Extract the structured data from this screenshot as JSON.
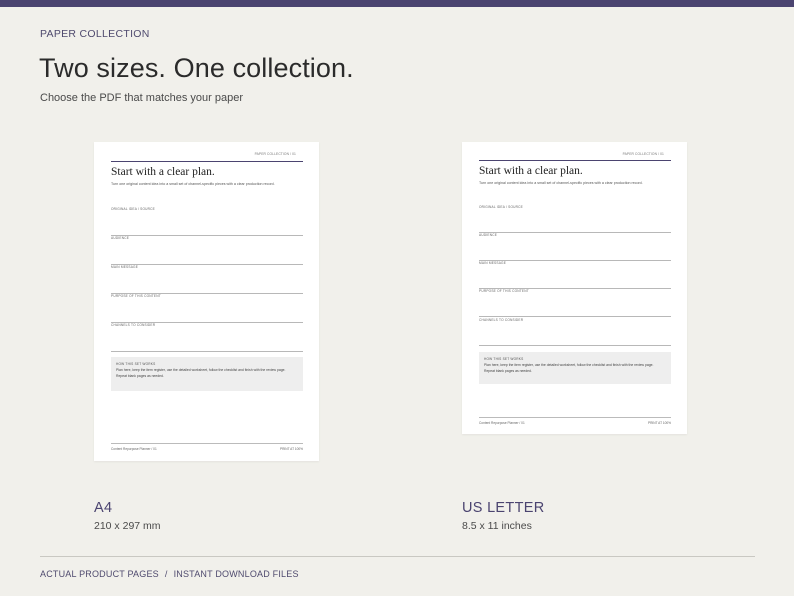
{
  "header": {
    "eyebrow": "PAPER COLLECTION",
    "headline": "Two sizes. One collection.",
    "subhead": "Choose the PDF that matches your paper"
  },
  "sheet": {
    "collection_label": "PAPER COLLECTION / 01",
    "title": "Start with a clear plan.",
    "intro": "Turn one original content idea into a small set of channel-specific pieces with a clear production record.",
    "fields": [
      "ORIGINAL IDEA / SOURCE",
      "AUDIENCE",
      "MAIN MESSAGE",
      "PURPOSE OF THIS CONTENT",
      "CHANNELS TO CONSIDER"
    ],
    "how_title": "HOW THIS SET WORKS",
    "how_line1": "Plan here, keep the item register, use the detailed worksheet, follow the checklist and finish with the review page.",
    "how_line2": "Repeat blank pages as needed.",
    "footer_left": "Content Repurpose Planner / 01",
    "footer_right_a4": "PRINT AT 100%",
    "footer_right_us": "PRINT AT 100%"
  },
  "sizes": [
    {
      "name": "A4",
      "dims": "210 x 297 mm"
    },
    {
      "name": "US LETTER",
      "dims": "8.5 x 11 inches"
    }
  ],
  "footer": {
    "left": "ACTUAL PRODUCT PAGES",
    "separator": "/",
    "right": "INSTANT DOWNLOAD FILES"
  },
  "colors": {
    "accent": "#4b4470",
    "background": "#f1f0eb",
    "paper": "#ffffff"
  }
}
